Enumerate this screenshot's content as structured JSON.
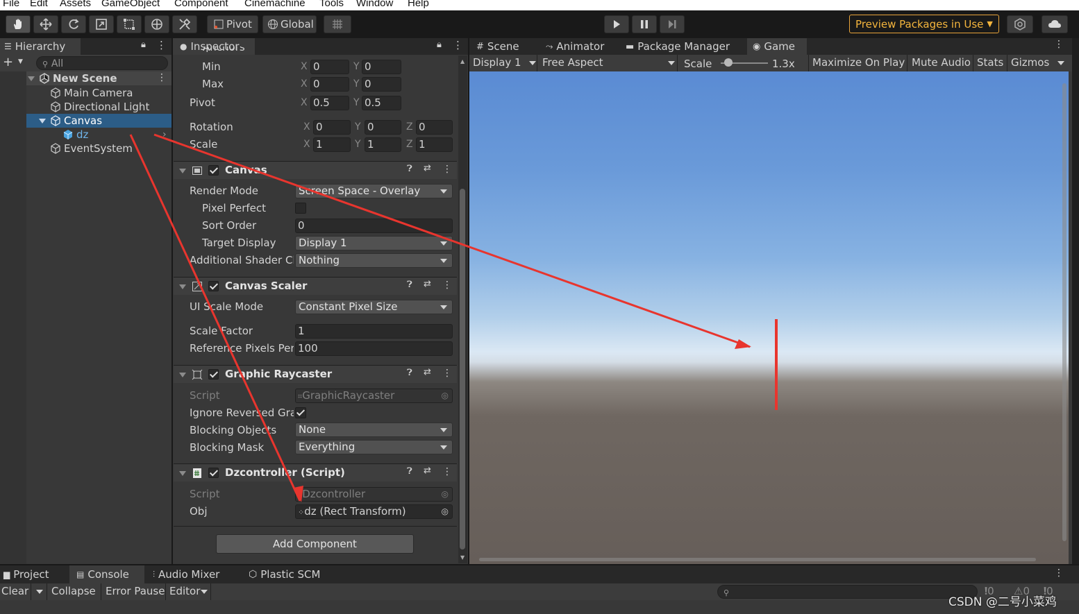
{
  "menubar": {
    "items": [
      "File",
      "Edit",
      "Assets",
      "GameObject",
      "Component",
      "Cinemachine",
      "Tools",
      "Window",
      "Help"
    ]
  },
  "toolbar": {
    "pivot_label": "Pivot",
    "global_label": "Global",
    "preview_label": "Preview Packages in Use",
    "tool_icons": [
      "hand-icon",
      "move-icon",
      "rotate-icon",
      "scale-icon",
      "rect-icon",
      "transform-icon",
      "custom-tools-icon"
    ]
  },
  "hierarchy": {
    "tab_label": "Hierarchy",
    "search_placeholder": "All",
    "scene": "New Scene",
    "items": [
      "Main Camera",
      "Directional Light",
      "Canvas",
      "dz",
      "EventSystem"
    ],
    "selected": "Canvas"
  },
  "inspector": {
    "tab_label": "Inspector",
    "clipped_header": "Anchors",
    "anchors": {
      "min_label": "Min",
      "min_x": "0",
      "min_y": "0",
      "max_label": "Max",
      "max_x": "0",
      "max_y": "0",
      "pivot_label": "Pivot",
      "pivot_x": "0.5",
      "pivot_y": "0.5"
    },
    "rotation": {
      "label": "Rotation",
      "x": "0",
      "y": "0",
      "z": "0"
    },
    "scale": {
      "label": "Scale",
      "x": "1",
      "y": "1",
      "z": "1"
    },
    "axis_x": "X",
    "axis_y": "Y",
    "axis_z": "Z",
    "canvas": {
      "title": "Canvas",
      "render_mode_label": "Render Mode",
      "render_mode": "Screen Space - Overlay",
      "pixel_perfect_label": "Pixel Perfect",
      "sort_order_label": "Sort Order",
      "sort_order": "0",
      "target_display_label": "Target Display",
      "target_display": "Display 1",
      "shader_label": "Additional Shader Ch",
      "shader": "Nothing"
    },
    "canvas_scaler": {
      "title": "Canvas Scaler",
      "ui_scale_label": "UI Scale Mode",
      "ui_scale": "Constant Pixel Size",
      "scale_factor_label": "Scale Factor",
      "scale_factor": "1",
      "ref_pixels_label": "Reference Pixels Per",
      "ref_pixels": "100"
    },
    "graphic_raycaster": {
      "title": "Graphic Raycaster",
      "script_label": "Script",
      "script": "GraphicRaycaster",
      "ignore_label": "Ignore Reversed Gra",
      "blocking_objects_label": "Blocking Objects",
      "blocking_objects": "None",
      "blocking_mask_label": "Blocking Mask",
      "blocking_mask": "Everything"
    },
    "dz_controller": {
      "title": "Dzcontroller (Script)",
      "script_label": "Script",
      "script": "Dzcontroller",
      "obj_label": "Obj",
      "obj": "dz (Rect Transform)"
    },
    "add_component": "Add Component"
  },
  "gamepanel": {
    "tabs": [
      "Scene",
      "Animator",
      "Package Manager",
      "Game"
    ],
    "active_tab": "Game",
    "display": "Display 1",
    "aspect": "Free Aspect",
    "scale_label": "Scale",
    "scale_value": "1.3x",
    "toggles": [
      "Maximize On Play",
      "Mute Audio",
      "Stats",
      "Gizmos"
    ]
  },
  "bottom": {
    "tabs": [
      "Project",
      "Console",
      "Audio Mixer",
      "Plastic SCM"
    ],
    "active_tab": "Console",
    "buttons": [
      "Clear",
      "Collapse",
      "Error Pause",
      "Editor"
    ],
    "counts": [
      "0",
      "0",
      "0"
    ]
  },
  "watermark": "CSDN @二号小菜鸡",
  "colors": {
    "accent_selected": "#2c5d87",
    "annotation_red": "#e8352e",
    "preview_border": "#e8a43a"
  }
}
